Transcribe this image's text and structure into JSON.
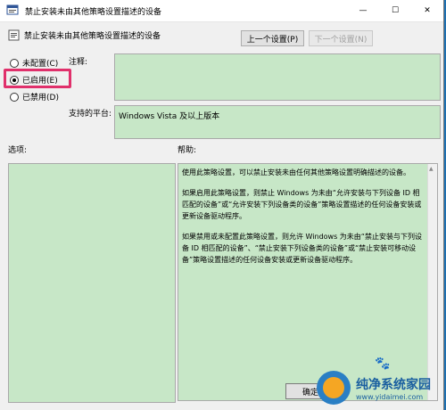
{
  "window": {
    "title": "禁止安装未由其他策略设置描述的设备",
    "min_glyph": "—",
    "max_glyph": "☐",
    "close_glyph": "✕"
  },
  "header": {
    "setting_title": "禁止安装未由其他策略设置描述的设备",
    "prev_button": "上一个设置(P)",
    "next_button": "下一个设置(N)"
  },
  "state": {
    "options": [
      {
        "label": "未配置(C)",
        "checked": false
      },
      {
        "label": "已启用(E)",
        "checked": true
      },
      {
        "label": "已禁用(D)",
        "checked": false
      }
    ]
  },
  "labels": {
    "comment": "注释:",
    "supported_on": "支持的平台:",
    "options": "选项:",
    "help": "帮助:"
  },
  "supported_on_value": "Windows Vista 及以上版本",
  "help_text": [
    "使用此策略设置，可以禁止安装未由任何其他策略设置明确描述的设备。",
    "如果启用此策略设置，则禁止 Windows 为未由“允许安装与下列设备 ID 相匹配的设备”或“允许安装下列设备类的设备”策略设置描述的任何设备安装或更新设备驱动程序。",
    "如果禁用或未配置此策略设置，则允许 Windows 为未由“禁止安装与下列设备 ID 相匹配的设备”、“禁止安装下列设备类的设备”或“禁止安装可移动设备”策略设置描述的任何设备安装或更新设备驱动程序。"
  ],
  "footer": {
    "ok_button": "确定"
  },
  "watermark": {
    "title": "纯净系统家园",
    "url": "www.yidaimei.com"
  },
  "colors": {
    "pane_bg": "#c7e7c7",
    "highlight": "#e0306b",
    "desktop": "#1d6fb0"
  }
}
